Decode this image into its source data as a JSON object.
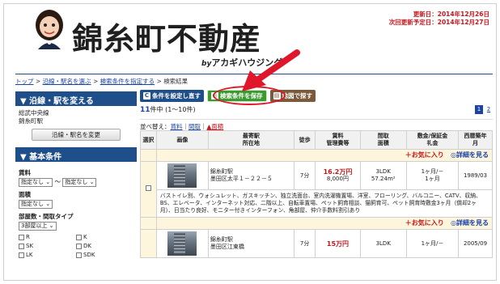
{
  "header": {
    "logo_text": "錦糸町不動産",
    "logo_sub_by": "by",
    "logo_sub_name": "アカギハウジング",
    "updated": "更新日：2014年12月26日",
    "next_update": "次回更新予定日：2014年12月27日"
  },
  "breadcrumb": {
    "top": "トップ",
    "sep": " > ",
    "route": "沿線・駅名を選ぶ",
    "cond": "検索条件を指定する",
    "result": "検索結果"
  },
  "sidebar": {
    "station_head": "▼ 沿線・駅を変える",
    "station_line1": "総武中央線",
    "station_line2": "錦糸町駅",
    "change_btn": "沿線・駅名を変更",
    "basic_head": "▼ 基本条件",
    "rent_label": "賃料",
    "rent_from": "指定なし ⌄",
    "rent_tilde": "〜",
    "rent_to": "指定なし ⌄",
    "area_label": "面積",
    "area_val": "指定なし ⌄",
    "layout_label": "部屋数・間取タイプ",
    "layout_val": "3部屋以上 ⌄",
    "layouts": [
      "R",
      "K",
      "SK",
      "DK",
      "LK",
      "SDK"
    ]
  },
  "toolbar": {
    "reset_label": "条件を設定し直す",
    "save_label": "検索条件を保存",
    "map_label": "地図で探す"
  },
  "results": {
    "count": "11",
    "count_text": "件中 (1〜10件)",
    "pages": [
      "1",
      "2"
    ],
    "sort_label": "並べ替え：",
    "sort_rent": "賃料",
    "sort_sep": "｜",
    "sort_layout": "間取",
    "sort_area": "▲面積"
  },
  "table": {
    "headers": [
      "選択",
      "画像",
      "最寄駅\n所在地",
      "徒歩",
      "賃料\n管理費等",
      "間取\n面積",
      "敷金/保証金\n礼金",
      "西暦築年\n月"
    ],
    "fav_label": "お気に入り",
    "detail_label": "詳細を見る",
    "rows": [
      {
        "station": "錦糸町駅",
        "address": "墨田区太平１－２２－５",
        "walk": "7分",
        "rent": "16.2万円",
        "fee": "8,000円",
        "layout": "3LDK",
        "area": "57.24m²",
        "deposit": "1ヶ月/－",
        "key": "1ヶ月",
        "built": "1989/03",
        "desc": "バストイレ別、ウォシュレット、ガスキッチン、独立洗面台、室内洗濯機置場、洋室、フローリング、バルコニー、CATV、収納、BS、エレベータ、インターネット対応、二階以上、自転車置場、ペット飼育相談、猫飼育可、ペット飼育時敷金3ヶ月（償却2ヶ月）、日当たり良好、モニター付きインターフォン、角部屋、仲介手数料割引あり"
      },
      {
        "station": "錦糸町駅",
        "address": "墨田区江東橋",
        "walk": "7分",
        "rent": "15万円",
        "fee": "",
        "layout": "3LDK",
        "area": "",
        "deposit": "1ヶ月/－",
        "key": "",
        "built": "2005/09",
        "desc": ""
      }
    ]
  },
  "colors": {
    "accent": "#1e4f8a",
    "highlight": "#e0162b",
    "price": "#c4161c"
  }
}
